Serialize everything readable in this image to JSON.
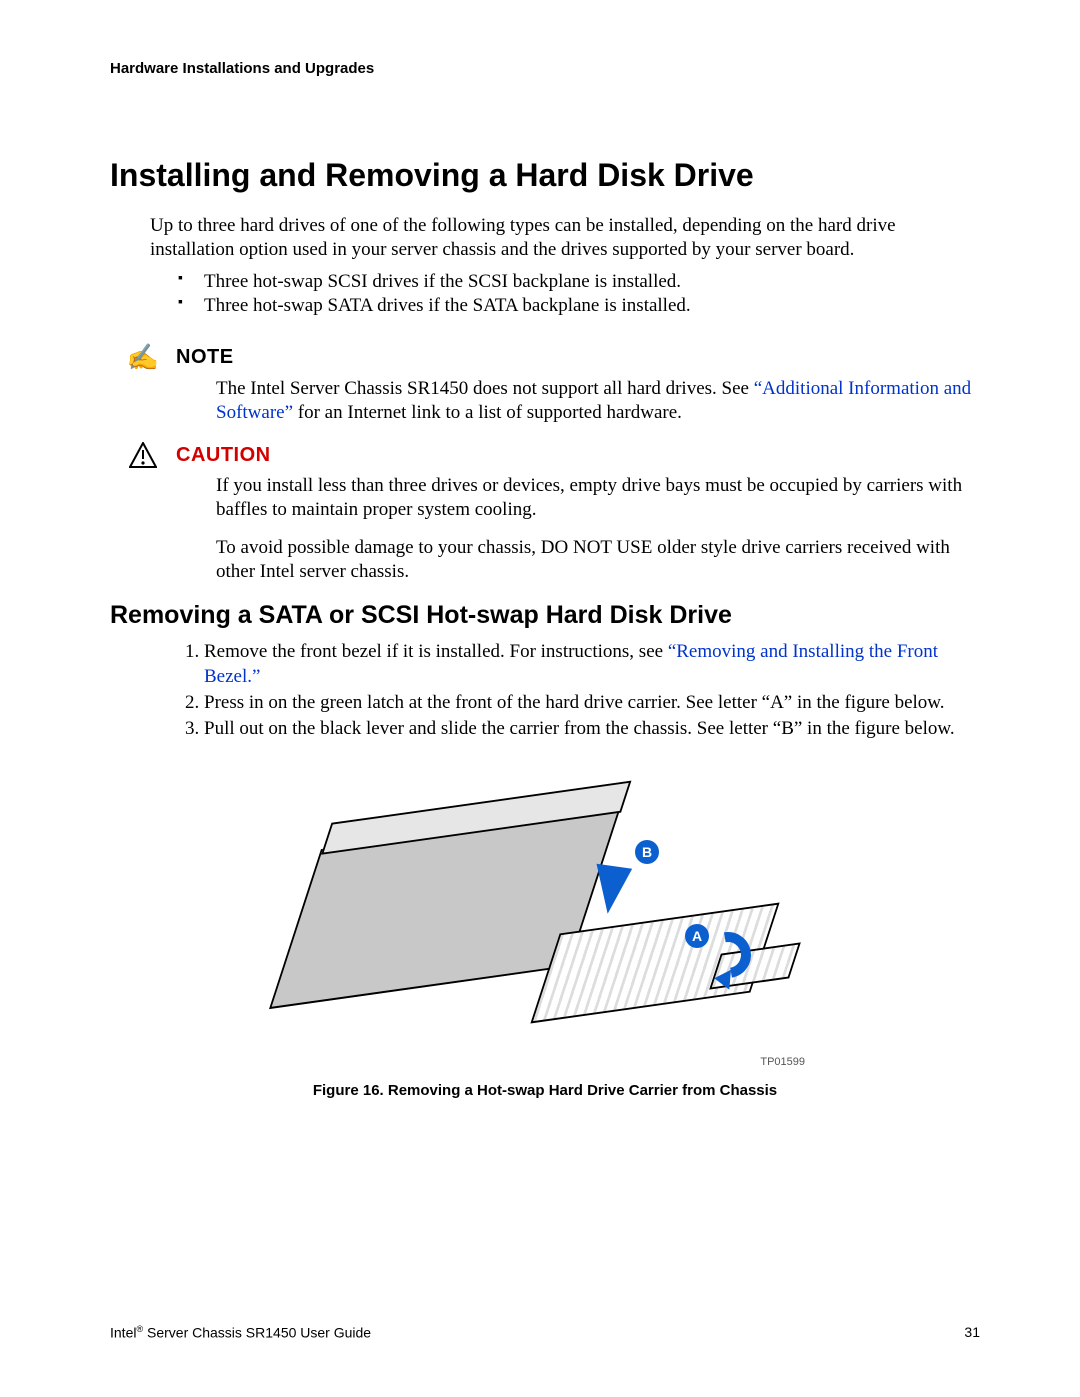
{
  "header": {
    "running": "Hardware Installations and Upgrades"
  },
  "title": "Installing and Removing a Hard Disk Drive",
  "intro": "Up to three hard drives of one of the following types can be installed, depending on the hard drive installation option used in your server chassis and the drives supported by your server board.",
  "bullets": [
    "Three hot-swap SCSI drives if the SCSI backplane is installed.",
    "Three hot-swap SATA drives if the SATA backplane is installed."
  ],
  "note": {
    "label": "NOTE",
    "body_pre": "The Intel Server Chassis SR1450 does not support all hard drives. See ",
    "link": "“Additional Information and Software”",
    "body_post": " for an Internet link to a list of supported hardware."
  },
  "caution": {
    "label": "CAUTION",
    "p1": "If you install less than three drives or devices, empty drive bays must be occupied by carriers with baffles to maintain proper system cooling.",
    "p2": "To avoid possible damage to your chassis, DO NOT USE older style drive carriers received with other Intel server chassis."
  },
  "subheading": "Removing a SATA or SCSI Hot-swap Hard Disk Drive",
  "steps": {
    "s1_pre": "Remove the front bezel if it is installed. For instructions, see ",
    "s1_link": "“Removing and Installing the Front Bezel.”",
    "s2": "Press in on the green latch at the front of the hard drive carrier. See letter “A” in the figure below.",
    "s3": "Pull out on the black lever and slide the carrier from the chassis. See letter “B” in the figure below."
  },
  "figure": {
    "label_A": "A",
    "label_B": "B",
    "tpid": "TP01599",
    "caption": "Figure 16.  Removing a Hot-swap Hard Drive Carrier from Chassis"
  },
  "footer": {
    "left_pre": "Intel",
    "left_reg": "®",
    "left_post": " Server Chassis SR1450 User Guide",
    "page": "31"
  }
}
